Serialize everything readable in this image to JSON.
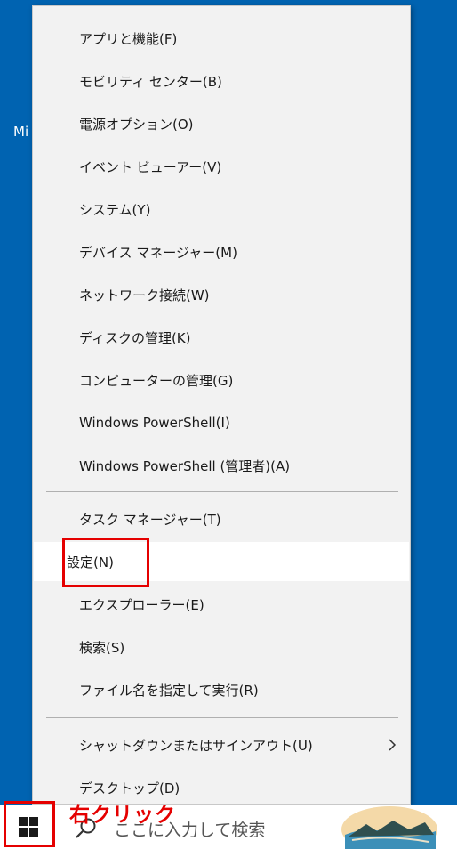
{
  "desktop": {
    "fragment_text": "Mi"
  },
  "context_menu": {
    "group1": [
      {
        "label": "アプリと機能(F)"
      },
      {
        "label": "モビリティ センター(B)"
      },
      {
        "label": "電源オプション(O)"
      },
      {
        "label": "イベント ビューアー(V)"
      },
      {
        "label": "システム(Y)"
      },
      {
        "label": "デバイス マネージャー(M)"
      },
      {
        "label": "ネットワーク接続(W)"
      },
      {
        "label": "ディスクの管理(K)"
      },
      {
        "label": "コンピューターの管理(G)"
      },
      {
        "label": "Windows PowerShell(I)"
      },
      {
        "label": "Windows PowerShell (管理者)(A)"
      }
    ],
    "group2": [
      {
        "label": "タスク マネージャー(T)"
      },
      {
        "label": "設定(N)",
        "selected": true
      },
      {
        "label": "エクスプローラー(E)"
      },
      {
        "label": "検索(S)"
      },
      {
        "label": "ファイル名を指定して実行(R)"
      }
    ],
    "group3": [
      {
        "label": "シャットダウンまたはサインアウト(U)",
        "submenu_icon": "chevron-right-icon"
      },
      {
        "label": "デスクトップ(D)"
      }
    ]
  },
  "taskbar": {
    "start_icon": "windows-logo-icon",
    "search_icon": "search-icon",
    "search_placeholder": "ここに入力して検索"
  },
  "annotation": {
    "text": "右クリック",
    "color": "#e50000"
  },
  "colors": {
    "desktop_background": "#0063B1",
    "menu_background": "#f2f2f2",
    "selected_background": "#ffffff",
    "highlight": "#e50000"
  }
}
